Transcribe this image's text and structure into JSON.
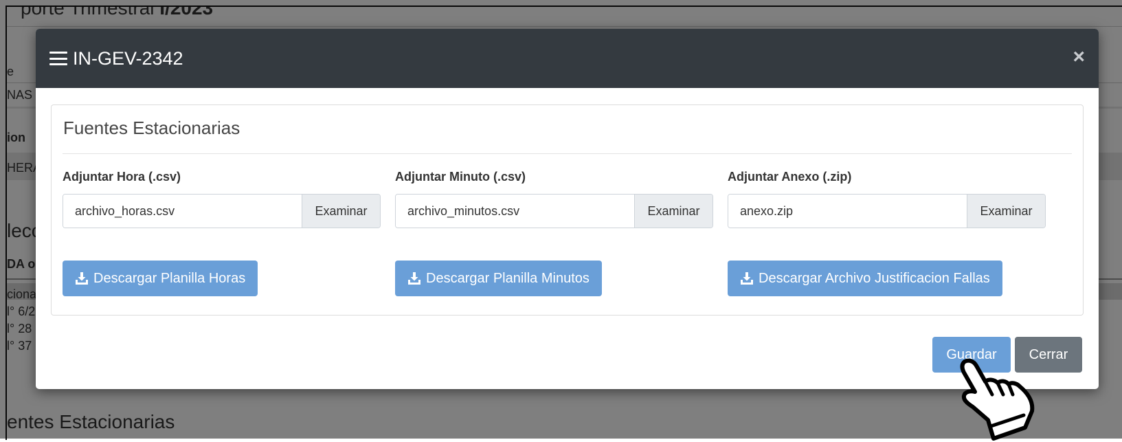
{
  "background": {
    "page_title_prefix": "porte Trimestral ",
    "page_title_bold": "I/2023",
    "frag_e": "e",
    "frag_nas": "NAS",
    "frag_ion": "ion",
    "frag_hera": "HERA",
    "frag_lecc": "lecc",
    "frag_dao": "DA o",
    "frag_ciona": "ciona",
    "frag_n6": "l° 6/2",
    "frag_n28": "l° 28",
    "frag_n37": "l° 37",
    "frag_bottom": "entes Estacionarias"
  },
  "modal": {
    "title": "IN-GEV-2342",
    "close_symbol": "×",
    "section_title": "Fuentes Estacionarias",
    "fields": [
      {
        "label": "Adjuntar Hora (.csv)",
        "file": "archivo_horas.csv",
        "browse": "Examinar",
        "download": "Descargar Planilla Horas"
      },
      {
        "label": "Adjuntar Minuto (.csv)",
        "file": "archivo_minutos.csv",
        "browse": "Examinar",
        "download": "Descargar Planilla Minutos"
      },
      {
        "label": "Adjuntar Anexo (.zip)",
        "file": "anexo.zip",
        "browse": "Examinar",
        "download": "Descargar Archivo Justificacion Fallas"
      }
    ],
    "save_label": "Guardar",
    "close_label": "Cerrar"
  },
  "colors": {
    "header_bg": "#343a40",
    "primary_button": "#6a9fd8",
    "secondary_button": "#6c757d"
  },
  "icons": {
    "menu": "hamburger-icon",
    "close": "close-icon",
    "download": "download-icon",
    "cursor": "hand-pointer-icon"
  }
}
